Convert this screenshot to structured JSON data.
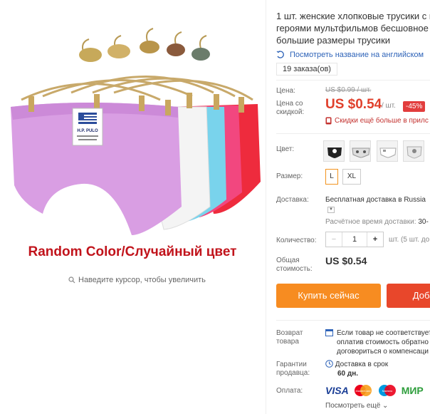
{
  "gallery": {
    "caption": "Random Color/Случайный цвет",
    "zoom_hint": "Наведите курсор, чтобы увеличить",
    "label_brand": "H.P. PULO"
  },
  "product": {
    "title_lines": [
      "1 шт. женские хлопковые трусики с п",
      "героями мультфильмов бесшовное ж",
      "большие размеры трусики"
    ],
    "translate_link": "Посмотреть название на английском",
    "orders": "19 заказа(ов)"
  },
  "price": {
    "price_label": "Цена:",
    "old_price": "US $0.99 / шт.",
    "discount_label": "Цена со скидкой:",
    "new_price": "US $0.54",
    "unit": "/ шт.",
    "discount_badge": "-45%",
    "promo": "Скидки ещё больше в прилс"
  },
  "options": {
    "color_label": "Цвет:",
    "size_label": "Размер:",
    "sizes": [
      "L",
      "XL"
    ]
  },
  "shipping": {
    "label": "Доставка:",
    "text": "Бесплатная доставка в Russia",
    "eta_label": "Расчётное время доставки:",
    "eta_value": "30-"
  },
  "quantity": {
    "label": "Количество:",
    "minus": "−",
    "value": "1",
    "plus": "+",
    "stock": "шт. (5 шт. до"
  },
  "total": {
    "label": "Общая стоимость:",
    "value": "US $0.54"
  },
  "actions": {
    "buy": "Купить сейчас",
    "cart": "Добав"
  },
  "buyer_protection": {
    "return_label": "Возврат товара",
    "return_lines": [
      "Если товар не соответствует",
      "оплатив стоимость обратно",
      "договориться о компенсаци"
    ],
    "guarantee_label": "Гарантии продавца:",
    "guarantee_text": "Доставка в срок",
    "guarantee_days": "60 дн.",
    "payment_label": "Оплата:",
    "payment_methods": [
      "VISA",
      "MasterCard",
      "Maestro",
      "МИР"
    ],
    "more_link": "Посмотреть ещё"
  },
  "colors": {
    "price_red": "#e0402c",
    "buy_orange": "#f78c21",
    "cart_red": "#e8472b",
    "badge_red": "#e23d3d",
    "link_blue": "#2e63b8",
    "caption_red": "#c1131b"
  }
}
